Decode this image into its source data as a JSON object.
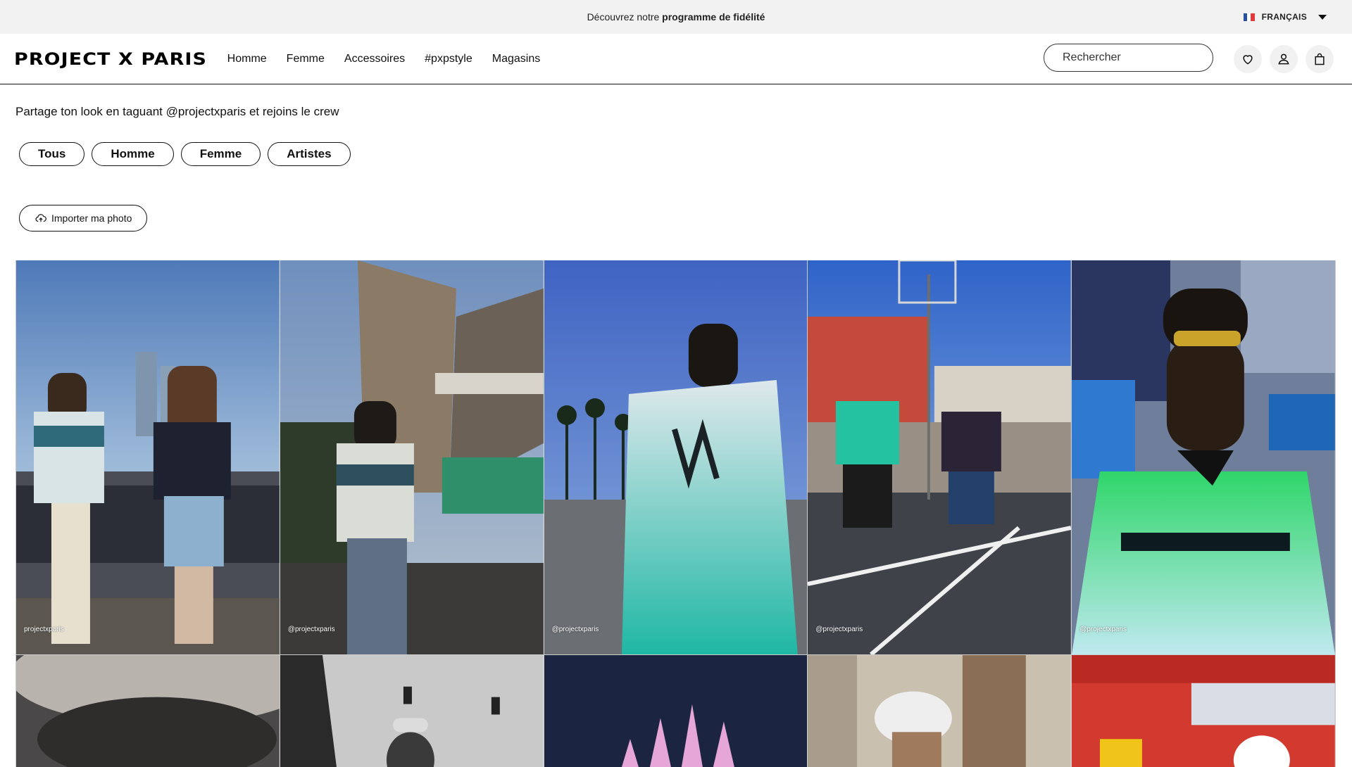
{
  "announcement": {
    "text_prefix": "Découvrez notre",
    "text_bold": "programme de fidélité"
  },
  "language": {
    "label": "FRANÇAIS",
    "flag_icon": "france-flag-icon"
  },
  "header": {
    "logo": "PROJECT X PARIS",
    "nav": [
      "Homme",
      "Femme",
      "Accessoires",
      "#pxpstyle",
      "Magasins"
    ],
    "search_placeholder": "Rechercher",
    "icons": [
      "heart-icon",
      "user-icon",
      "bag-icon"
    ]
  },
  "page": {
    "tagline": "Partage ton look en taguant @projectxparis et rejoins le crew",
    "filters": [
      "Tous",
      "Homme",
      "Femme",
      "Artistes"
    ],
    "upload_label": "Importer ma photo",
    "upload_icon": "cloud-upload-icon"
  },
  "gallery": {
    "row1": [
      {
        "handle": "projectxparis"
      },
      {
        "handle": "@projectxparis"
      },
      {
        "handle": "@projectxparis"
      },
      {
        "handle": "@projectxparis"
      },
      {
        "handle": "@projectxparis"
      }
    ],
    "row2_count": 5
  },
  "colors": {
    "topbar_bg": "#f2f2f2",
    "icon_bg": "#f1f1f1",
    "text": "#111111"
  }
}
